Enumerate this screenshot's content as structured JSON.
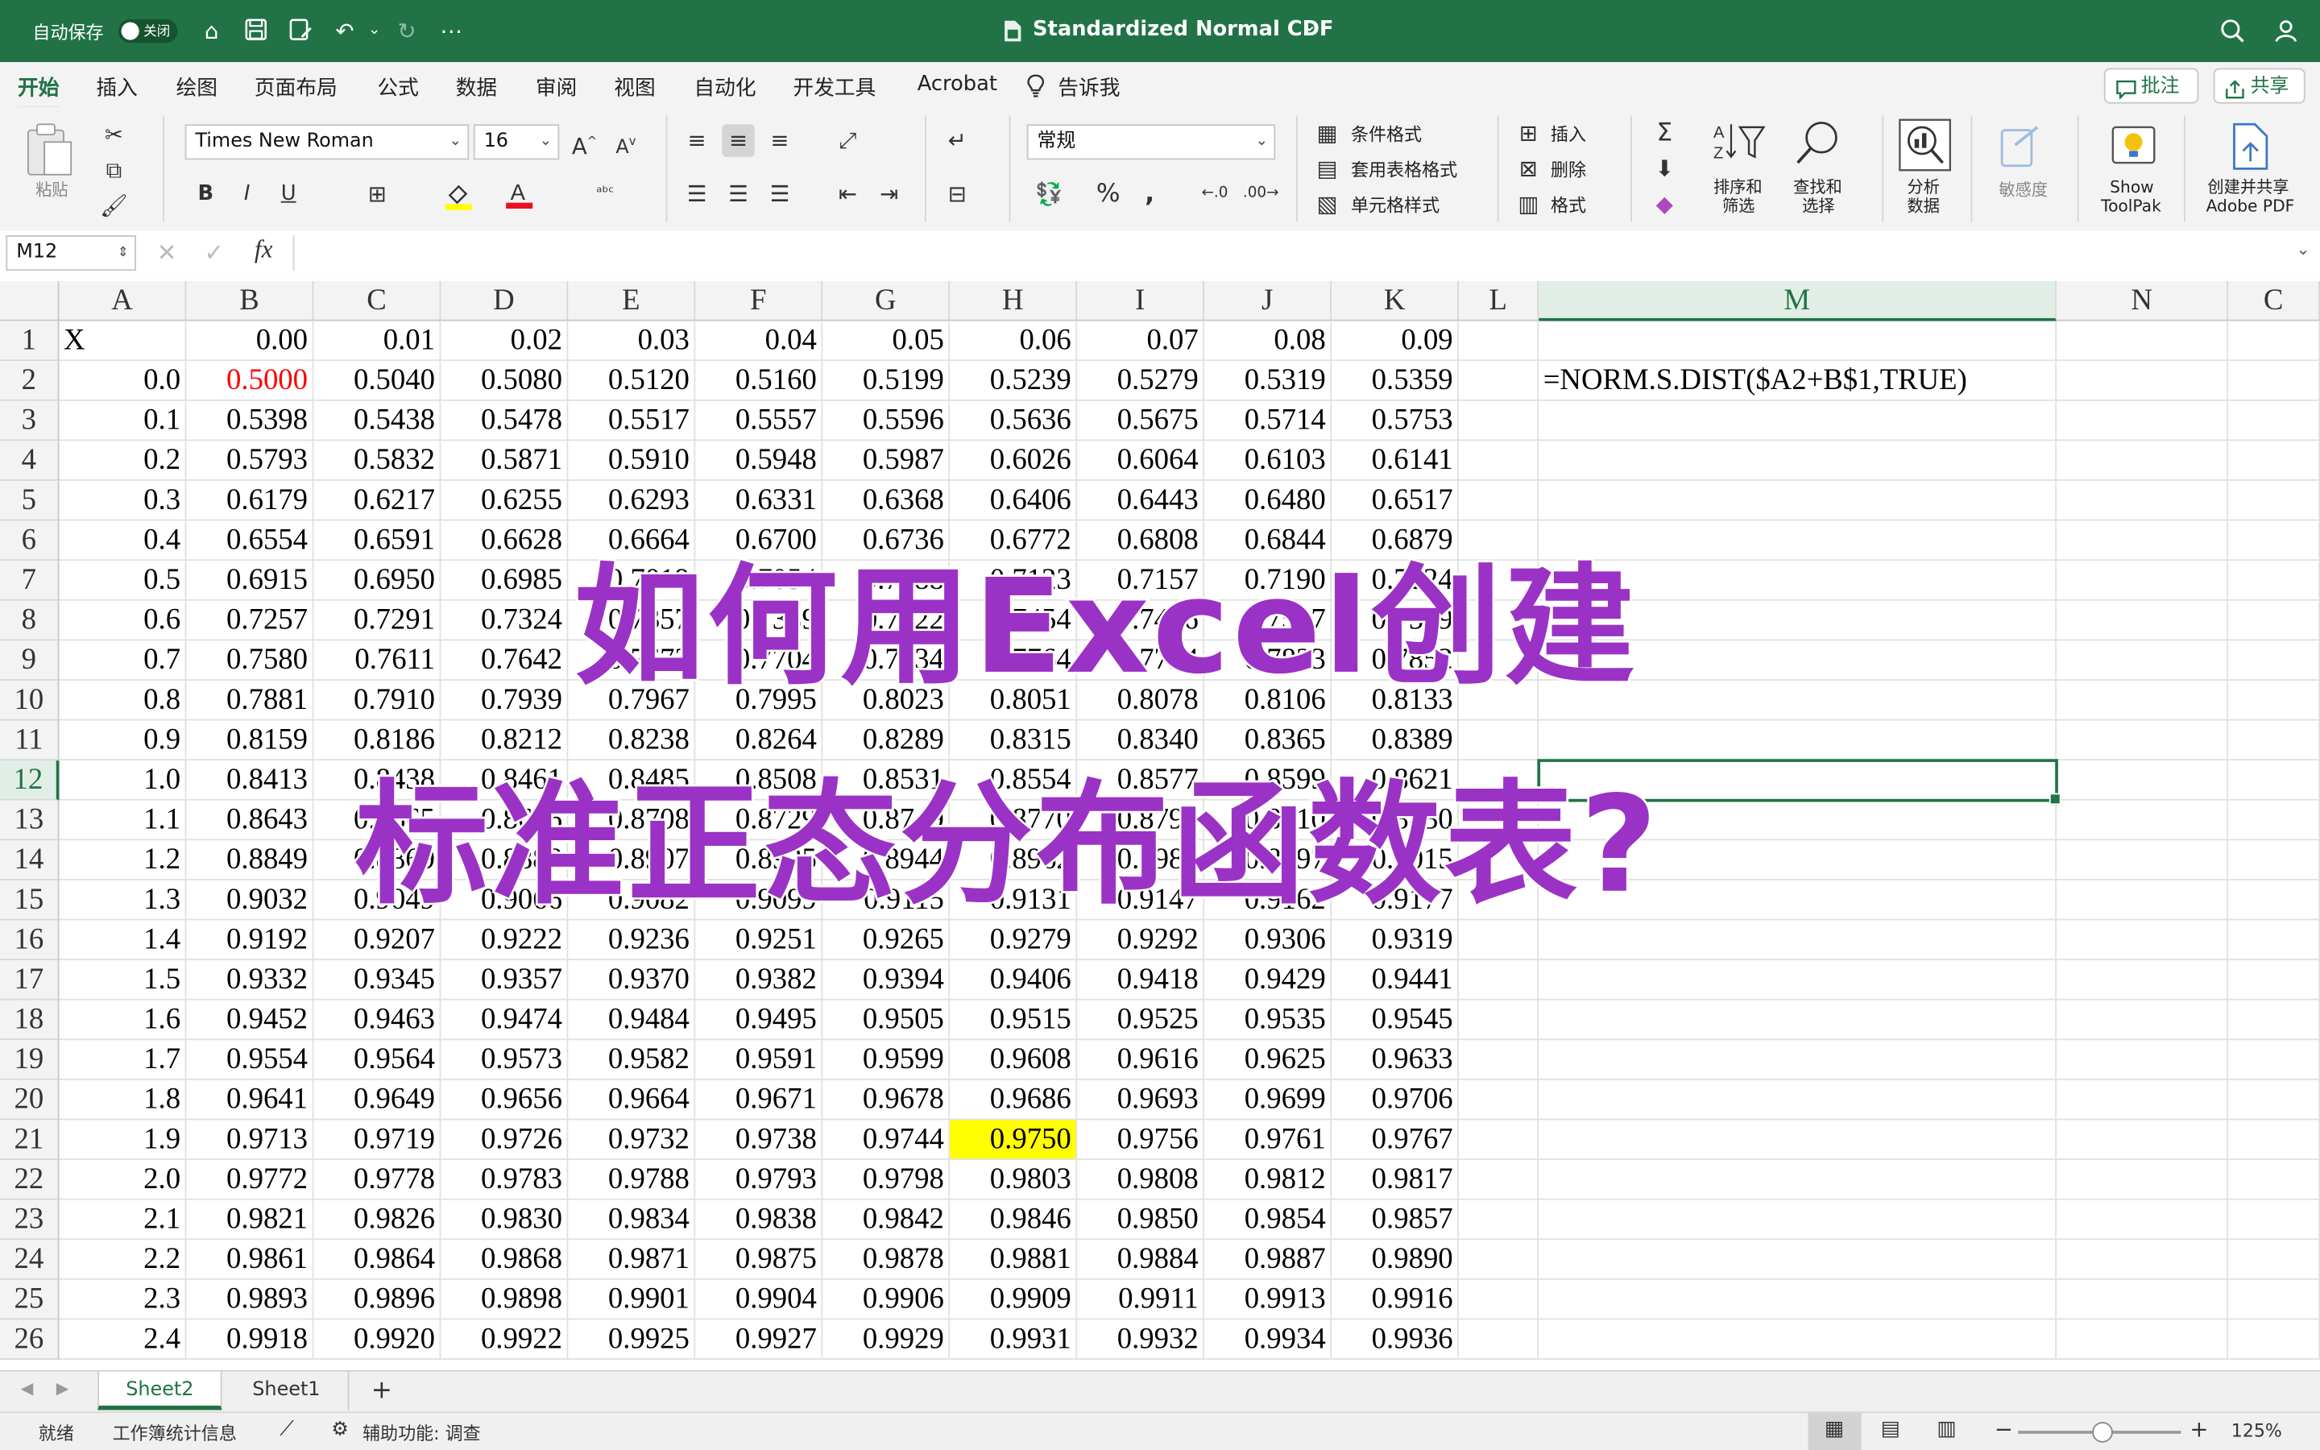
{
  "titlebar": {
    "autosave_label": "自动保存",
    "autosave_state": "关闭",
    "doc_title": "Standardized Normal CDF",
    "chevron": "⌄"
  },
  "menu": {
    "tabs": [
      "开始",
      "插入",
      "绘图",
      "页面布局",
      "公式",
      "数据",
      "审阅",
      "视图",
      "自动化",
      "开发工具",
      "Acrobat"
    ],
    "tell_me": "告诉我",
    "comments_label": "批注",
    "share_label": "共享"
  },
  "ribbon": {
    "paste_label": "粘贴",
    "font_name": "Times New Roman",
    "font_size": "16",
    "number_format": "常规",
    "cond_format": "条件格式",
    "table_format": "套用表格格式",
    "cell_style": "单元格样式",
    "insert": "插入",
    "delete": "删除",
    "format": "格式",
    "sort_filter": [
      "排序和",
      "筛选"
    ],
    "find_select": [
      "查找和",
      "选择"
    ],
    "analyze": [
      "分析",
      "数据"
    ],
    "sensitivity": "敏感度",
    "show_toolpak": [
      "Show",
      "ToolPak"
    ],
    "create_pdf": [
      "创建并共享",
      "Adobe PDF"
    ]
  },
  "formula_bar": {
    "name_box": "M12",
    "fx": "fx"
  },
  "grid": {
    "columns": [
      "A",
      "B",
      "C",
      "D",
      "E",
      "F",
      "G",
      "H",
      "I",
      "J",
      "K",
      "L",
      "M",
      "N",
      "C"
    ],
    "selected_column": "M",
    "selected_row": "12",
    "rows": [
      "1",
      "2",
      "3",
      "4",
      "5",
      "6",
      "7",
      "8",
      "9",
      "10",
      "11",
      "12",
      "13",
      "14",
      "15",
      "16",
      "17",
      "18",
      "19",
      "20",
      "21",
      "22",
      "23",
      "24",
      "25",
      "26"
    ],
    "header_row": [
      "X",
      "0.00",
      "0.01",
      "0.02",
      "0.03",
      "0.04",
      "0.05",
      "0.06",
      "0.07",
      "0.08",
      "0.09"
    ],
    "x_values": [
      "0.0",
      "0.1",
      "0.2",
      "0.3",
      "0.4",
      "0.5",
      "0.6",
      "0.7",
      "0.8",
      "0.9",
      "1.0",
      "1.1",
      "1.2",
      "1.3",
      "1.4",
      "1.5",
      "1.6",
      "1.7",
      "1.8",
      "1.9",
      "2.0",
      "2.1",
      "2.2",
      "2.3",
      "2.4"
    ],
    "table": [
      [
        "0.5000",
        "0.5040",
        "0.5080",
        "0.5120",
        "0.5160",
        "0.5199",
        "0.5239",
        "0.5279",
        "0.5319",
        "0.5359"
      ],
      [
        "0.5398",
        "0.5438",
        "0.5478",
        "0.5517",
        "0.5557",
        "0.5596",
        "0.5636",
        "0.5675",
        "0.5714",
        "0.5753"
      ],
      [
        "0.5793",
        "0.5832",
        "0.5871",
        "0.5910",
        "0.5948",
        "0.5987",
        "0.6026",
        "0.6064",
        "0.6103",
        "0.6141"
      ],
      [
        "0.6179",
        "0.6217",
        "0.6255",
        "0.6293",
        "0.6331",
        "0.6368",
        "0.6406",
        "0.6443",
        "0.6480",
        "0.6517"
      ],
      [
        "0.6554",
        "0.6591",
        "0.6628",
        "0.6664",
        "0.6700",
        "0.6736",
        "0.6772",
        "0.6808",
        "0.6844",
        "0.6879"
      ],
      [
        "0.6915",
        "0.6950",
        "0.6985",
        "0.7019",
        "0.7054",
        "0.7088",
        "0.7123",
        "0.7157",
        "0.7190",
        "0.7224"
      ],
      [
        "0.7257",
        "0.7291",
        "0.7324",
        "0.7357",
        "0.7389",
        "0.7422",
        "0.7454",
        "0.7486",
        "0.7517",
        "0.7549"
      ],
      [
        "0.7580",
        "0.7611",
        "0.7642",
        "0.7673",
        "0.7704",
        "0.7734",
        "0.7764",
        "0.7794",
        "0.7823",
        "0.7852"
      ],
      [
        "0.7881",
        "0.7910",
        "0.7939",
        "0.7967",
        "0.7995",
        "0.8023",
        "0.8051",
        "0.8078",
        "0.8106",
        "0.8133"
      ],
      [
        "0.8159",
        "0.8186",
        "0.8212",
        "0.8238",
        "0.8264",
        "0.8289",
        "0.8315",
        "0.8340",
        "0.8365",
        "0.8389"
      ],
      [
        "0.8413",
        "0.8438",
        "0.8461",
        "0.8485",
        "0.8508",
        "0.8531",
        "0.8554",
        "0.8577",
        "0.8599",
        "0.8621"
      ],
      [
        "0.8643",
        "0.8665",
        "0.8686",
        "0.8708",
        "0.8729",
        "0.8749",
        "0.8770",
        "0.8790",
        "0.8810",
        "0.8830"
      ],
      [
        "0.8849",
        "0.8869",
        "0.8888",
        "0.8907",
        "0.8925",
        "0.8944",
        "0.8962",
        "0.8980",
        "0.8997",
        "0.9015"
      ],
      [
        "0.9032",
        "0.9049",
        "0.9066",
        "0.9082",
        "0.9099",
        "0.9115",
        "0.9131",
        "0.9147",
        "0.9162",
        "0.9177"
      ],
      [
        "0.9192",
        "0.9207",
        "0.9222",
        "0.9236",
        "0.9251",
        "0.9265",
        "0.9279",
        "0.9292",
        "0.9306",
        "0.9319"
      ],
      [
        "0.9332",
        "0.9345",
        "0.9357",
        "0.9370",
        "0.9382",
        "0.9394",
        "0.9406",
        "0.9418",
        "0.9429",
        "0.9441"
      ],
      [
        "0.9452",
        "0.9463",
        "0.9474",
        "0.9484",
        "0.9495",
        "0.9505",
        "0.9515",
        "0.9525",
        "0.9535",
        "0.9545"
      ],
      [
        "0.9554",
        "0.9564",
        "0.9573",
        "0.9582",
        "0.9591",
        "0.9599",
        "0.9608",
        "0.9616",
        "0.9625",
        "0.9633"
      ],
      [
        "0.9641",
        "0.9649",
        "0.9656",
        "0.9664",
        "0.9671",
        "0.9678",
        "0.9686",
        "0.9693",
        "0.9699",
        "0.9706"
      ],
      [
        "0.9713",
        "0.9719",
        "0.9726",
        "0.9732",
        "0.9738",
        "0.9744",
        "0.9750",
        "0.9756",
        "0.9761",
        "0.9767"
      ],
      [
        "0.9772",
        "0.9778",
        "0.9783",
        "0.9788",
        "0.9793",
        "0.9798",
        "0.9803",
        "0.9808",
        "0.9812",
        "0.9817"
      ],
      [
        "0.9821",
        "0.9826",
        "0.9830",
        "0.9834",
        "0.9838",
        "0.9842",
        "0.9846",
        "0.9850",
        "0.9854",
        "0.9857"
      ],
      [
        "0.9861",
        "0.9864",
        "0.9868",
        "0.9871",
        "0.9875",
        "0.9878",
        "0.9881",
        "0.9884",
        "0.9887",
        "0.9890"
      ],
      [
        "0.9893",
        "0.9896",
        "0.9898",
        "0.9901",
        "0.9904",
        "0.9906",
        "0.9909",
        "0.9911",
        "0.9913",
        "0.9916"
      ],
      [
        "0.9918",
        "0.9920",
        "0.9922",
        "0.9925",
        "0.9927",
        "0.9929",
        "0.9931",
        "0.9932",
        "0.9934",
        "0.9936"
      ]
    ],
    "formula_text": "=NORM.S.DIST($A2+B$1,TRUE)",
    "red_color": "#ff0000",
    "highlight_color": "#ffff00"
  },
  "overlay": {
    "line1": "如何用Excel创建",
    "line2": "标准正态分布函数表?",
    "color": "#9b32c6"
  },
  "sheets": {
    "tabs": [
      "Sheet2",
      "Sheet1"
    ],
    "active": "Sheet2",
    "add": "+"
  },
  "status": {
    "ready": "就绪",
    "workbook_stats": "工作簿统计信息",
    "accessibility": "辅助功能: 调查",
    "zoom": "125%"
  },
  "theme": {
    "accent": "#217346"
  }
}
